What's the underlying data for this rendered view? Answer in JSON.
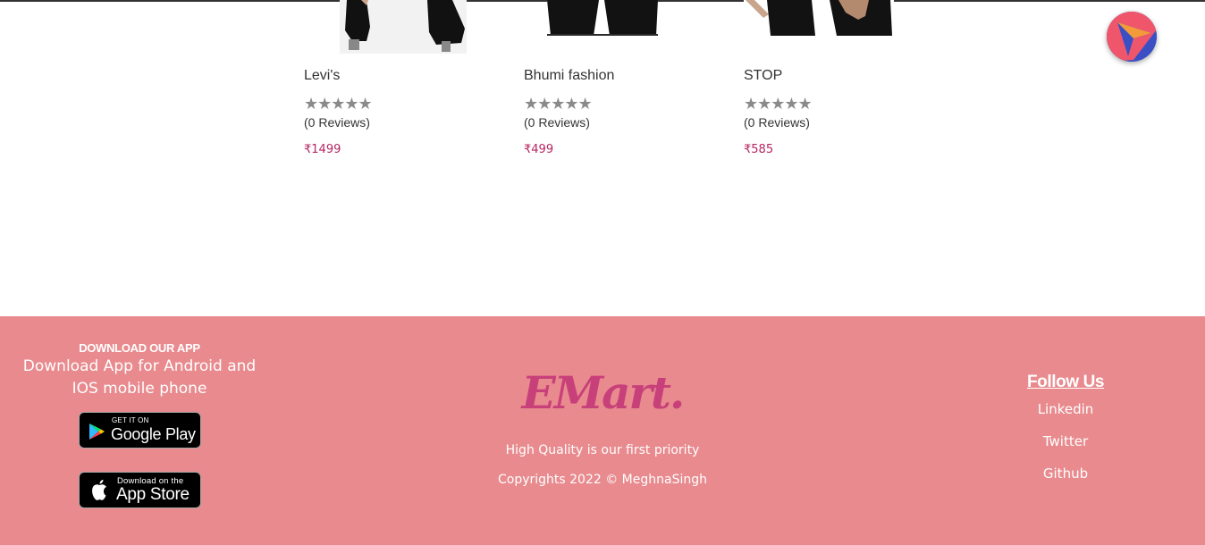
{
  "products": [
    {
      "name": "Levi's",
      "stars": "★★★★★",
      "reviews": "(0 Reviews)",
      "price": "₹1499"
    },
    {
      "name": "Bhumi fashion",
      "stars": "★★★★★",
      "reviews": "(0 Reviews)",
      "price": "₹499"
    },
    {
      "name": "STOP",
      "stars": "★★★★★",
      "reviews": "(0 Reviews)",
      "price": "₹585"
    }
  ],
  "footer": {
    "app": {
      "heading": "DOWNLOAD OUR APP",
      "description": "Download App for Android and IOS mobile phone",
      "google_small": "GET IT ON",
      "google_big": "Google Play",
      "apple_small": "Download on the",
      "apple_big": "App Store"
    },
    "brand": {
      "logo": "EMart.",
      "tagline": "High Quality is our first priority",
      "copyright": "Copyrights 2022 © MeghnaSingh"
    },
    "follow": {
      "title": "Follow Us",
      "links": [
        "Linkedin",
        "Twitter",
        "Github"
      ]
    }
  },
  "colors": {
    "footer_bg": "#e88a8e",
    "price": "#b5265f",
    "logo": "#c8407a",
    "star": "#8a8a8a"
  },
  "icons": {
    "fab": "navigation-arrow-icon",
    "google": "google-play-icon",
    "apple": "apple-icon"
  }
}
